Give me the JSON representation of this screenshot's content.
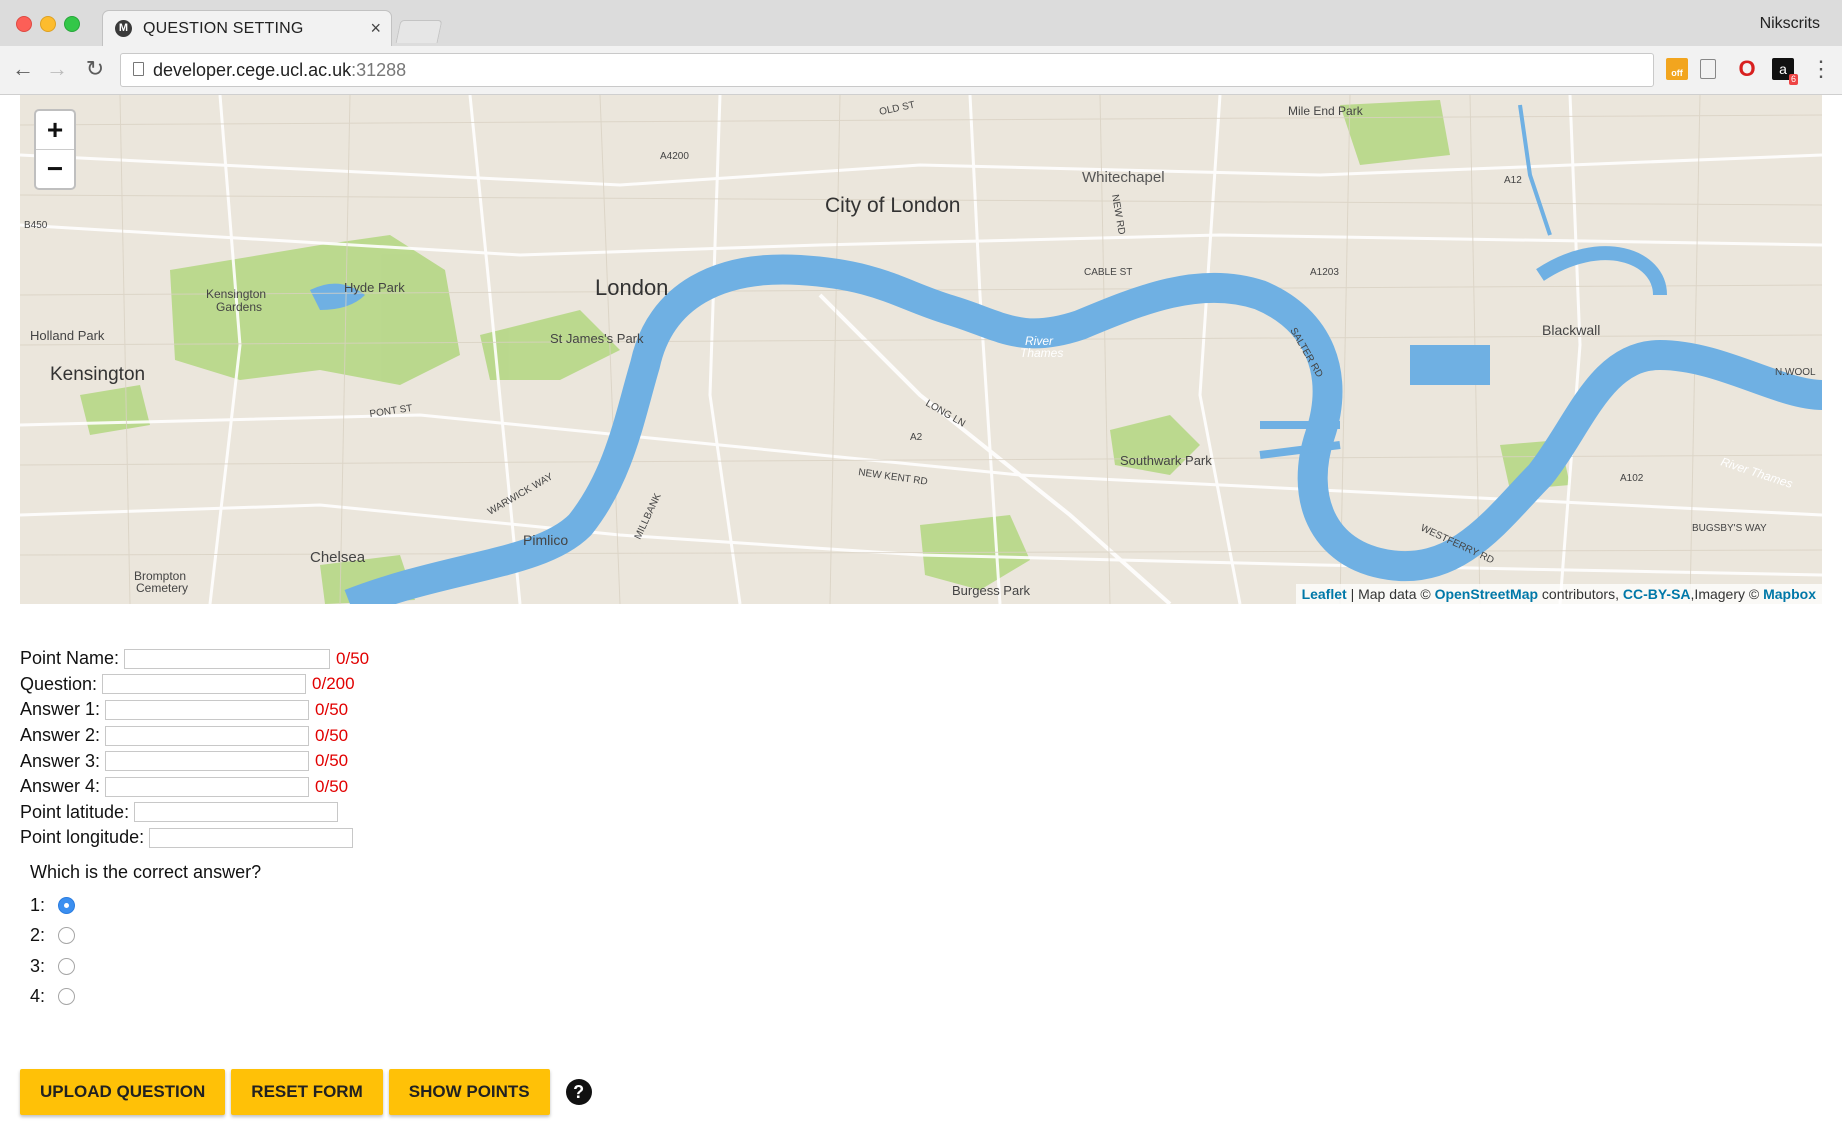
{
  "browser": {
    "tab_title": "QUESTION SETTING",
    "tab_close": "×",
    "profile_name": "Nikscrits",
    "url_host": "developer.cege.ucl.ac.uk",
    "url_port": ":31288",
    "extensions": [
      "off",
      "document-icon",
      "opera-icon",
      "accessibility-icon"
    ],
    "ext_off_label": "off",
    "ext_badge": "6",
    "menu_icon": "⋮"
  },
  "map": {
    "zoom_in": "+",
    "zoom_out": "−",
    "labels": {
      "city_of_london": "City of London",
      "london": "London",
      "kensington": "Kensington",
      "whitechapel": "Whitechapel",
      "hyde_park": "Hyde Park",
      "kensington_gardens_1": "Kensington",
      "kensington_gardens_2": "Gardens",
      "holland_park": "Holland Park",
      "st_james_park": "St James's Park",
      "chelsea": "Chelsea",
      "pimlico": "Pimlico",
      "brompton_1": "Brompton",
      "brompton_2": "Cemetery",
      "southwark_park": "Southwark Park",
      "burgess_park": "Burgess Park",
      "blackwall": "Blackwall",
      "mile_end_park": "Mile End Park",
      "river_thames": "River Thames",
      "river": "River",
      "thames": "Thames",
      "a4200": "A4200",
      "b450": "B450",
      "a12": "A12",
      "a1203": "A1203",
      "a2": "A2",
      "a102": "A102",
      "cable_st": "CABLE ST",
      "new_kent_rd": "NEW KENT RD",
      "long_ln": "LONG LN",
      "pont_st": "PONT ST",
      "old_st": "OLD ST",
      "new_rd": "NEW RD",
      "salter_rd": "SALTER RD",
      "westferry_rd": "WESTFERRY RD",
      "bugsbys_way": "BUGSBY'S WAY",
      "warwick_way": "WARWICK WAY",
      "millbank": "MILLBANK",
      "n_wool": "N.WOOL"
    },
    "attribution": {
      "leaflet": "Leaflet",
      "sep": " | Map data © ",
      "osm": "OpenStreetMap",
      "contrib": " contributors, ",
      "ccbysa": "CC-BY-SA",
      "imagery": ",Imagery © ",
      "mapbox": "Mapbox"
    }
  },
  "form": {
    "fields": [
      {
        "label": "Point Name:",
        "value": "",
        "counter": "0/50"
      },
      {
        "label": "Question:",
        "value": "",
        "counter": "0/200"
      },
      {
        "label": "Answer 1:",
        "value": "",
        "counter": "0/50"
      },
      {
        "label": "Answer 2:",
        "value": "",
        "counter": "0/50"
      },
      {
        "label": "Answer 3:",
        "value": "",
        "counter": "0/50"
      },
      {
        "label": "Answer 4:",
        "value": "",
        "counter": "0/50"
      },
      {
        "label": "Point latitude:",
        "value": ""
      },
      {
        "label": "Point longitude:",
        "value": ""
      }
    ],
    "correct_question": "Which is the correct answer?",
    "options": [
      "1:",
      "2:",
      "3:",
      "4:"
    ],
    "selected_option": "1:"
  },
  "buttons": {
    "upload": "UPLOAD QUESTION",
    "reset": "RESET FORM",
    "show": "SHOW POINTS",
    "help": "?"
  },
  "colors": {
    "accent_button": "#ffc107",
    "counter_red": "#e10000",
    "river_blue": "#6fb0e3",
    "park_green": "#b8d889",
    "link_blue": "#0078a8"
  }
}
